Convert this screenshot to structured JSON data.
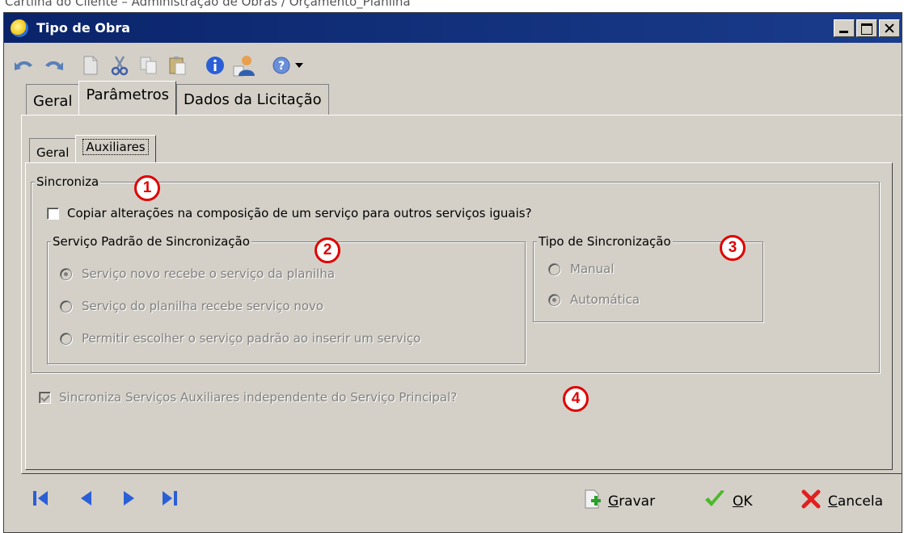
{
  "page_header": "Cartilha do Cliente – Administração de Obras / Orçamento_Planilha",
  "window": {
    "title": "Tipo de Obra",
    "controls": [
      "minimize",
      "maximize",
      "close"
    ]
  },
  "toolbar": {
    "icons": [
      "undo-icon",
      "redo-icon",
      "new-icon",
      "cut-icon",
      "copy-icon",
      "paste-icon",
      "info-icon",
      "user-icon",
      "help-icon",
      "dropdown-icon"
    ]
  },
  "tabs": [
    {
      "label": "Geral",
      "selected": false
    },
    {
      "label": "Parâmetros",
      "selected": true
    },
    {
      "label": "Dados da Licitação",
      "selected": false
    }
  ],
  "subtabs": [
    {
      "label": "Geral",
      "selected": false
    },
    {
      "label": "Auxiliares",
      "selected": true
    }
  ],
  "sincroniza": {
    "legend": "Sincroniza",
    "copy_checkbox_label": "Copiar alterações na composição de um serviço para outros serviços iguais?",
    "copy_checked": false,
    "servico_padrao": {
      "legend": "Serviço Padrão de Sincronização",
      "options": [
        {
          "label": "Serviço novo recebe o serviço da planilha",
          "selected": true
        },
        {
          "label": "Serviço do planilha recebe serviço novo",
          "selected": false
        },
        {
          "label": "Permitir escolher o serviço padrão ao inserir um serviço",
          "selected": false
        }
      ]
    },
    "tipo": {
      "legend": "Tipo de Sincronização",
      "options": [
        {
          "label": "Manual",
          "selected": false
        },
        {
          "label": "Automática",
          "selected": true
        }
      ]
    }
  },
  "aux_checkbox_label": "Sincroniza Serviços Auxiliares independente do Serviço Principal?",
  "aux_checked": true,
  "callouts": [
    "1",
    "2",
    "3",
    "4"
  ],
  "bottom": {
    "gravar": "Gravar",
    "ok": "OK",
    "cancela": "Cancela"
  },
  "colors": {
    "titlebar": "#0a246a",
    "face": "#d4d0c8",
    "callout": "#e00000",
    "nav": "#2a5fd6"
  }
}
